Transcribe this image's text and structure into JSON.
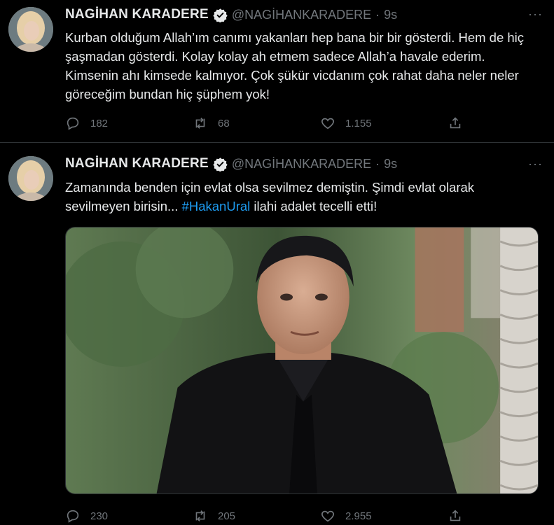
{
  "tweets": [
    {
      "author_name": "NAGİHAN KARADERE",
      "handle": "@NAGİHANKARADERE",
      "separator": "·",
      "time": "9s",
      "more_label": "···",
      "text": "Kurban olduğum Allah’ım canımı yakanları hep bana bir bir gösterdi. Hem de hiç şaşmadan gösterdi. Kolay kolay ah etmem sadece Allah’a havale ederim. Kimsenin ahı kimsede kalmıyor. Çok şükür vicdanım çok rahat daha neler neler göreceğim bundan hiç şüphem yok!",
      "replies": "182",
      "retweets": "68",
      "likes": "1.155"
    },
    {
      "author_name": "NAGİHAN KARADERE",
      "handle": "@NAGİHANKARADERE",
      "separator": "·",
      "time": "9s",
      "more_label": "···",
      "text_before": "Zamanında benden için evlat olsa sevilmez demiştin. Şimdi evlat olarak sevilmeyen birisin... ",
      "hashtag": "#HakanUral",
      "text_after": " ilahi adalet tecelli etti!",
      "replies": "230",
      "retweets": "205",
      "likes": "2.955"
    }
  ],
  "icons": {
    "verified": "verified-badge-icon",
    "reply": "reply-icon",
    "retweet": "retweet-icon",
    "like": "like-icon",
    "share": "share-icon"
  },
  "colors": {
    "background": "#000000",
    "text": "#e7e9ea",
    "muted": "#71767b",
    "link": "#1d9bf0",
    "divider": "#2f3336"
  }
}
